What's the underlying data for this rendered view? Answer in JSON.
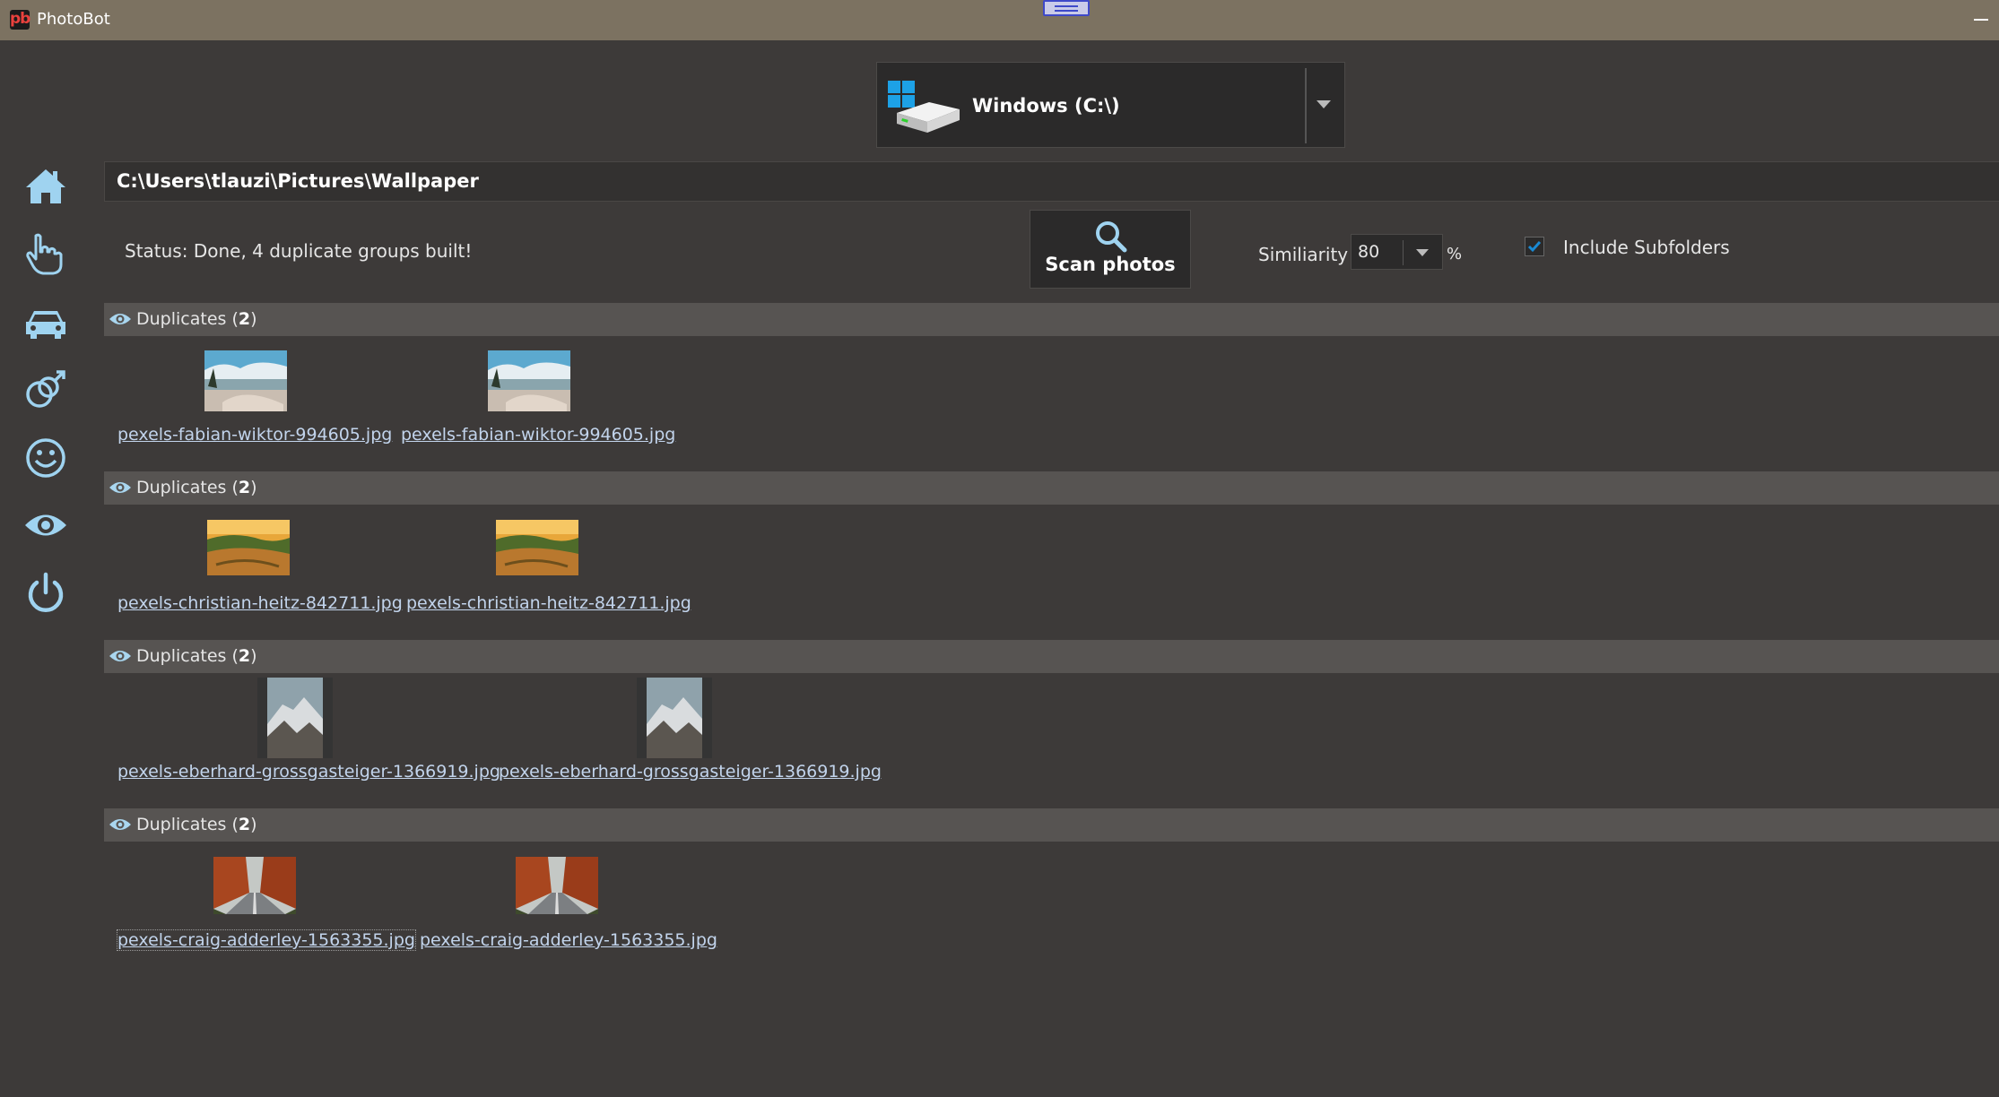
{
  "window": {
    "title": "PhotoBot",
    "logo_text": "pb"
  },
  "sidebar": {
    "items": [
      {
        "name": "home-icon"
      },
      {
        "name": "pointing-hand-icon"
      },
      {
        "name": "car-icon"
      },
      {
        "name": "gender-icon"
      },
      {
        "name": "smiley-icon"
      },
      {
        "name": "eye-icon"
      },
      {
        "name": "power-icon"
      }
    ],
    "icon_color": "#9fd3f0"
  },
  "drive": {
    "label": "Windows (C:\\)"
  },
  "path": {
    "value": "C:\\Users\\tlauzi\\Pictures\\Wallpaper"
  },
  "status": {
    "text": "Status: Done, 4 duplicate groups built!"
  },
  "scan": {
    "label": "Scan photos"
  },
  "similarity": {
    "label": "Similiarity",
    "value": "80",
    "unit": "%"
  },
  "subfolders": {
    "label": "Include Subfolders",
    "checked": true
  },
  "groups": [
    {
      "title": "Duplicates",
      "count": "2",
      "files": [
        "pexels-fabian-wiktor-994605.jpg",
        "pexels-fabian-wiktor-994605.jpg"
      ]
    },
    {
      "title": "Duplicates",
      "count": "2",
      "files": [
        "pexels-christian-heitz-842711.jpg",
        "pexels-christian-heitz-842711.jpg"
      ]
    },
    {
      "title": "Duplicates",
      "count": "2",
      "files": [
        "pexels-eberhard-grossgasteiger-1366919.jpg",
        "pexels-eberhard-grossgasteiger-1366919.jpg"
      ]
    },
    {
      "title": "Duplicates",
      "count": "2",
      "files": [
        "pexels-craig-adderley-1563355.jpg",
        "pexels-craig-adderley-1563355.jpg"
      ]
    }
  ],
  "colors": {
    "background": "#3d3a39",
    "titlebar": "#7c7261",
    "link": "#c2d4ec",
    "group_header": "#575452",
    "accent": "#1a8ad4"
  }
}
